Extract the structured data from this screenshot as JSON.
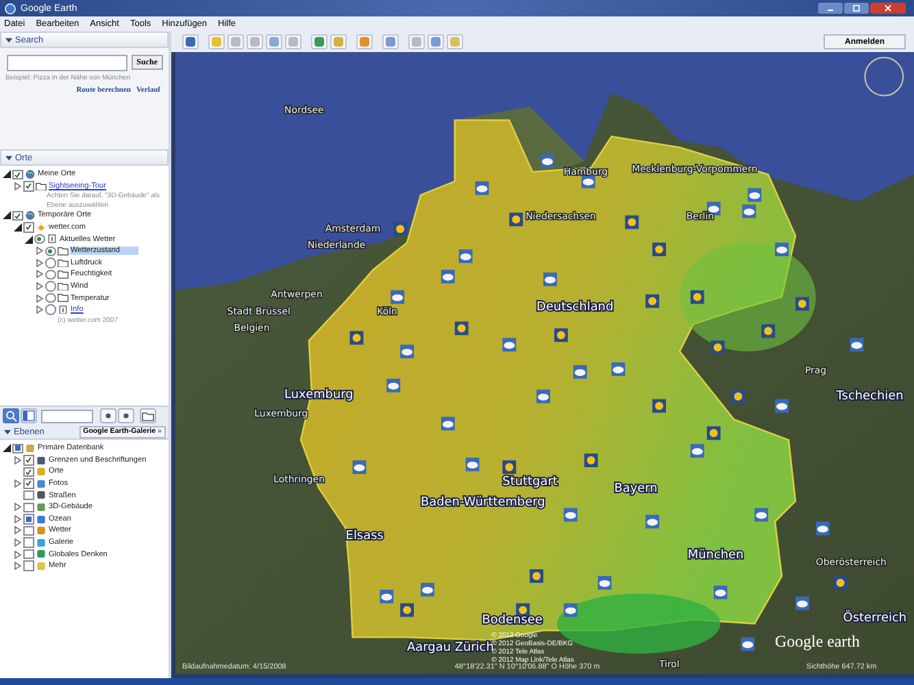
{
  "window": {
    "title": "Google Earth"
  },
  "menu": [
    "Datei",
    "Bearbeiten",
    "Ansicht",
    "Tools",
    "Hinzufügen",
    "Hilfe"
  ],
  "search": {
    "header": "Search",
    "button": "Suche",
    "hint": "Beispiel: Pizza in der Nähe von München",
    "links": [
      "Route berechnen",
      "Verlauf"
    ]
  },
  "places": {
    "header": "Orte",
    "items": [
      {
        "label": "Meine Orte",
        "kind": "places",
        "radio": false,
        "checked": true,
        "expandable": true,
        "expanded": true,
        "selected": false,
        "link": false,
        "children": [
          {
            "label": "Sightseeing-Tour",
            "kind": "folder",
            "radio": false,
            "checked": true,
            "expandable": true,
            "expanded": false,
            "selected": false,
            "link": true,
            "note": "Achten Sie darauf, \"3D-Gebäude\" als Ebene auszuwählen"
          }
        ]
      },
      {
        "label": "Temporäre Orte",
        "kind": "places",
        "radio": false,
        "checked": true,
        "expandable": true,
        "expanded": true,
        "selected": false,
        "link": false,
        "children": [
          {
            "label": "wetter.com",
            "kind": "sun",
            "radio": false,
            "checked": true,
            "expandable": true,
            "expanded": true,
            "selected": false,
            "link": false,
            "children": [
              {
                "label": "Aktuelles Wetter",
                "kind": "info",
                "radio": true,
                "checked": true,
                "expandable": true,
                "expanded": true,
                "selected": false,
                "link": false,
                "children": [
                  {
                    "label": "Wetterzustand",
                    "kind": "folder",
                    "radio": true,
                    "checked": true,
                    "expandable": true,
                    "expanded": false,
                    "selected": true,
                    "link": false
                  },
                  {
                    "label": "Luftdruck",
                    "kind": "folder",
                    "radio": true,
                    "checked": false,
                    "expandable": true,
                    "expanded": false,
                    "selected": false,
                    "link": false
                  },
                  {
                    "label": "Feuchtigkeit",
                    "kind": "folder",
                    "radio": true,
                    "checked": false,
                    "expandable": true,
                    "expanded": false,
                    "selected": false,
                    "link": false
                  },
                  {
                    "label": "Wind",
                    "kind": "folder",
                    "radio": true,
                    "checked": false,
                    "expandable": true,
                    "expanded": false,
                    "selected": false,
                    "link": false
                  },
                  {
                    "label": "Temperatur",
                    "kind": "folder",
                    "radio": true,
                    "checked": false,
                    "expandable": true,
                    "expanded": false,
                    "selected": false,
                    "link": false
                  },
                  {
                    "label": "Info",
                    "kind": "info",
                    "radio": true,
                    "checked": false,
                    "expandable": true,
                    "expanded": false,
                    "selected": false,
                    "link": true
                  }
                ]
              }
            ],
            "note": "(c) wetter.com 2007"
          }
        ]
      }
    ]
  },
  "layers": {
    "header": "Ebenen",
    "gallery_button": "Google Earth-Galerie",
    "gallery_arrow": "»",
    "items": [
      {
        "label": "Primäre Datenbank",
        "kind": "database",
        "partial": true,
        "expandable": true,
        "expanded": true,
        "children": [
          {
            "label": "Grenzen und Beschriftungen",
            "kind": "flag",
            "checked": true,
            "expandable": true,
            "expanded": false
          },
          {
            "label": "Orte",
            "kind": "place",
            "checked": true,
            "expandable": false
          },
          {
            "label": "Fotos",
            "kind": "photo",
            "checked": true,
            "expandable": true,
            "expanded": false
          },
          {
            "label": "Straßen",
            "kind": "road",
            "checked": false,
            "expandable": false
          },
          {
            "label": "3D-Gebäude",
            "kind": "building",
            "checked": false,
            "expandable": true,
            "expanded": false
          },
          {
            "label": "Ozean",
            "kind": "ocean",
            "partial": true,
            "expandable": true,
            "expanded": false
          },
          {
            "label": "Wetter",
            "kind": "weather",
            "checked": false,
            "expandable": true,
            "expanded": false
          },
          {
            "label": "Galerie",
            "kind": "gallery",
            "checked": false,
            "expandable": true,
            "expanded": false
          },
          {
            "label": "Globales Denken",
            "kind": "globe",
            "checked": false,
            "expandable": true,
            "expanded": false
          },
          {
            "label": "Mehr",
            "kind": "more",
            "checked": false,
            "expandable": true,
            "expanded": false
          }
        ]
      }
    ]
  },
  "toolbar": {
    "sign_in": "Anmelden"
  },
  "map": {
    "labels": [
      "Nordsee",
      "Hamburg",
      "Mecklenburg-Vorpommern",
      "Niedersachsen",
      "Berlin",
      "Amsterdam",
      "Niederlande",
      "Antwerpen",
      "Stadt Brüssel",
      "Belgien",
      "Köln",
      "Deutschland",
      "Prag",
      "Tschechien",
      "Luxemburg",
      "Luxemburg",
      "Lothringen",
      "Stuttgart",
      "Baden-Württemberg",
      "Bayern",
      "Elsass",
      "München",
      "Oberösterreich",
      "Bodensee",
      "Aargau Zürich",
      "Tirol",
      "Österreich"
    ],
    "copyright": [
      "© 2012 Google",
      "© 2012 GeoBasis-DE/BKG",
      "© 2012 Tele Atlas",
      "© 2012 Map Link/Tele Atlas"
    ],
    "logo": "Google earth",
    "status": {
      "imagery_date": "Bildaufnahmedatum: 4/15/2008",
      "coordinates": "48°18'22.31\" N  10°10'06.88\" O  Höhe  370 m",
      "eye_altitude": "Sichthöhe  647.72 km"
    }
  }
}
